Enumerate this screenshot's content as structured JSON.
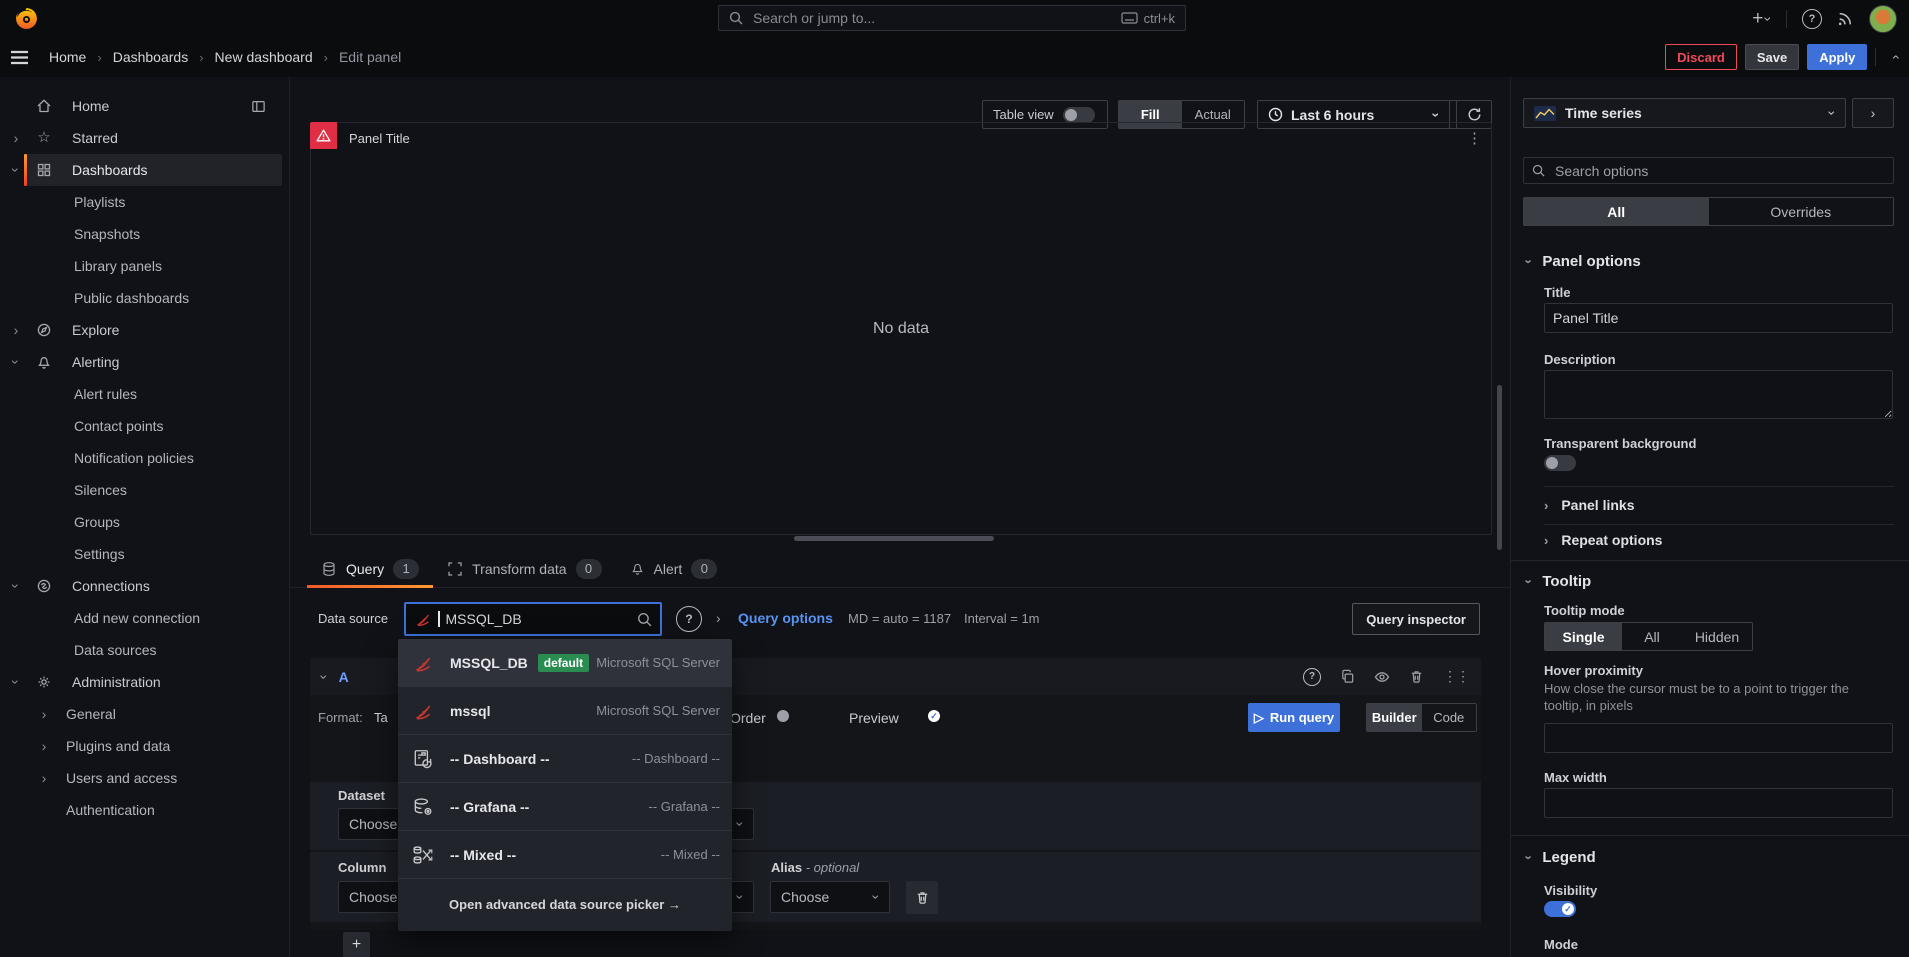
{
  "topbar": {
    "search_placeholder": "Search or jump to...",
    "shortcut": "ctrl+k"
  },
  "breadcrumb": {
    "items": [
      "Home",
      "Dashboards",
      "New dashboard",
      "Edit panel"
    ]
  },
  "header_actions": {
    "discard": "Discard",
    "save": "Save",
    "apply": "Apply"
  },
  "sidebar": {
    "items": [
      {
        "label": "Home"
      },
      {
        "label": "Starred"
      },
      {
        "label": "Dashboards"
      },
      {
        "label": "Playlists"
      },
      {
        "label": "Snapshots"
      },
      {
        "label": "Library panels"
      },
      {
        "label": "Public dashboards"
      },
      {
        "label": "Explore"
      },
      {
        "label": "Alerting"
      },
      {
        "label": "Alert rules"
      },
      {
        "label": "Contact points"
      },
      {
        "label": "Notification policies"
      },
      {
        "label": "Silences"
      },
      {
        "label": "Groups"
      },
      {
        "label": "Settings"
      },
      {
        "label": "Connections"
      },
      {
        "label": "Add new connection"
      },
      {
        "label": "Data sources"
      },
      {
        "label": "Administration"
      },
      {
        "label": "General"
      },
      {
        "label": "Plugins and data"
      },
      {
        "label": "Users and access"
      },
      {
        "label": "Authentication"
      }
    ]
  },
  "viewbar": {
    "table_view": "Table view",
    "fill": "Fill",
    "actual": "Actual",
    "time_range": "Last 6 hours"
  },
  "panel": {
    "title": "Panel Title",
    "no_data": "No data"
  },
  "editor_tabs": {
    "query": "Query",
    "query_count": "1",
    "transform": "Transform data",
    "transform_count": "0",
    "alert": "Alert",
    "alert_count": "0"
  },
  "datasource_bar": {
    "label": "Data source",
    "input_value": "MSSQL_DB",
    "query_options": "Query options",
    "max_data_points": "MD = auto = 1187",
    "interval": "Interval = 1m",
    "query_inspector": "Query inspector"
  },
  "datasource_dropdown": {
    "items": [
      {
        "name": "MSSQL_DB",
        "badge": "default",
        "type": "Microsoft SQL Server"
      },
      {
        "name": "mssql",
        "type": "Microsoft SQL Server"
      },
      {
        "name": "-- Dashboard --",
        "type": "-- Dashboard --"
      },
      {
        "name": "-- Grafana --",
        "type": "-- Grafana --"
      },
      {
        "name": "-- Mixed --",
        "type": "-- Mixed --"
      }
    ],
    "footer": "Open advanced data source picker →"
  },
  "query_editor": {
    "ref_id": "A",
    "format_label": "Format:",
    "format_value": "Ta",
    "order_label": "Order",
    "preview_label": "Preview",
    "run_query": "Run query",
    "builder": "Builder",
    "code": "Code",
    "dataset_label": "Dataset",
    "dataset_value": "Choose",
    "column_label": "Column",
    "column_value": "Choose",
    "alias_label": "Alias",
    "alias_suffix": "- optional",
    "alias_value": "Choose",
    "add_label": "+"
  },
  "options_pane": {
    "visualization": "Time series",
    "search_placeholder": "Search options",
    "tab_all": "All",
    "tab_overrides": "Overrides",
    "panel_options": {
      "header": "Panel options",
      "title_label": "Title",
      "title_value": "Panel Title",
      "description_label": "Description",
      "transparent_label": "Transparent background",
      "panel_links": "Panel links",
      "repeat_options": "Repeat options"
    },
    "tooltip": {
      "header": "Tooltip",
      "mode_label": "Tooltip mode",
      "mode_single": "Single",
      "mode_all": "All",
      "mode_hidden": "Hidden",
      "hover_label": "Hover proximity",
      "hover_desc": "How close the cursor must be to a point to trigger the tooltip, in pixels",
      "max_width_label": "Max width"
    },
    "legend": {
      "header": "Legend",
      "visibility_label": "Visibility",
      "mode_label": "Mode"
    }
  },
  "colors": {
    "accent_blue": "#3d71d9",
    "link_blue": "#5794f2",
    "brand_orange": "#f05a28",
    "error_red": "#e02f44",
    "discard_red": "#f2495c",
    "default_badge_green": "#2b8c52"
  }
}
